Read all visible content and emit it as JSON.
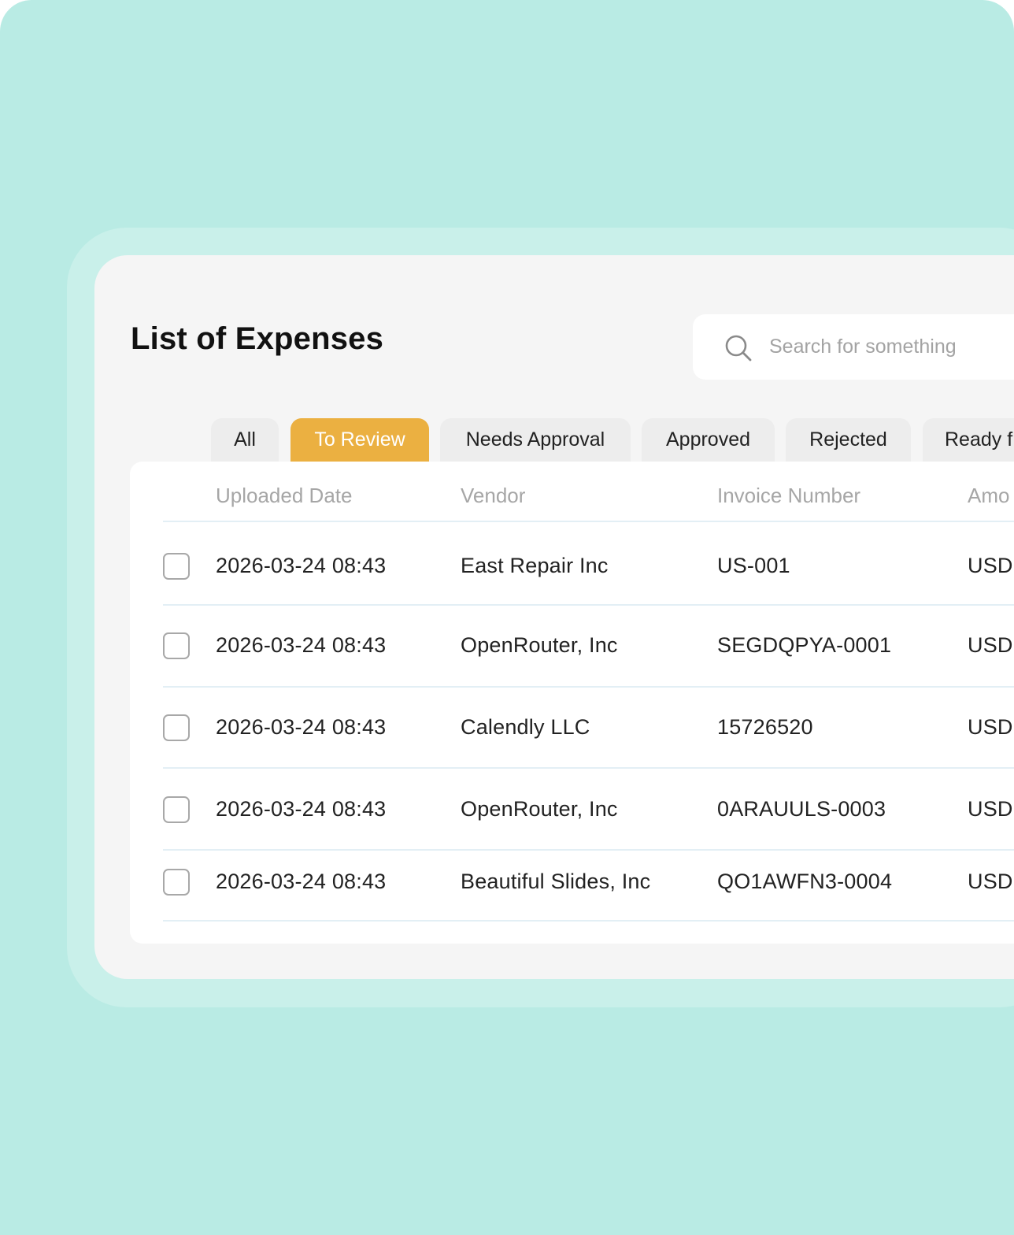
{
  "page": {
    "title": "List of Expenses"
  },
  "search": {
    "placeholder": "Search for something",
    "icon": "search-icon"
  },
  "tabs": [
    {
      "label": "All",
      "active": false
    },
    {
      "label": "To Review",
      "active": true
    },
    {
      "label": "Needs Approval",
      "active": false
    },
    {
      "label": "Approved",
      "active": false
    },
    {
      "label": "Rejected",
      "active": false
    },
    {
      "label": "Ready f",
      "active": false
    }
  ],
  "table": {
    "columns": [
      "Uploaded Date",
      "Vendor",
      "Invoice Number",
      "Amo"
    ],
    "rows": [
      {
        "date": "2026-03-24 08:43",
        "vendor": "East Repair Inc",
        "invoice": "US-001",
        "amount": "USD"
      },
      {
        "date": "2026-03-24 08:43",
        "vendor": "OpenRouter, Inc",
        "invoice": "SEGDQPYA-0001",
        "amount": "USD"
      },
      {
        "date": "2026-03-24 08:43",
        "vendor": "Calendly LLC",
        "invoice": "15726520",
        "amount": "USD"
      },
      {
        "date": "2026-03-24 08:43",
        "vendor": "OpenRouter, Inc",
        "invoice": "0ARAUULS-0003",
        "amount": "USD"
      },
      {
        "date": "2026-03-24 08:43",
        "vendor": "Beautiful Slides, Inc",
        "invoice": "QO1AWFN3-0004",
        "amount": "USD"
      }
    ]
  },
  "colors": {
    "background": "#b9ebe4",
    "halo": "#c9f0ea",
    "panel": "#f5f5f5",
    "active_tab": "#ebb041",
    "inactive_tab": "#ededed",
    "header_text": "#a6a6a6"
  }
}
